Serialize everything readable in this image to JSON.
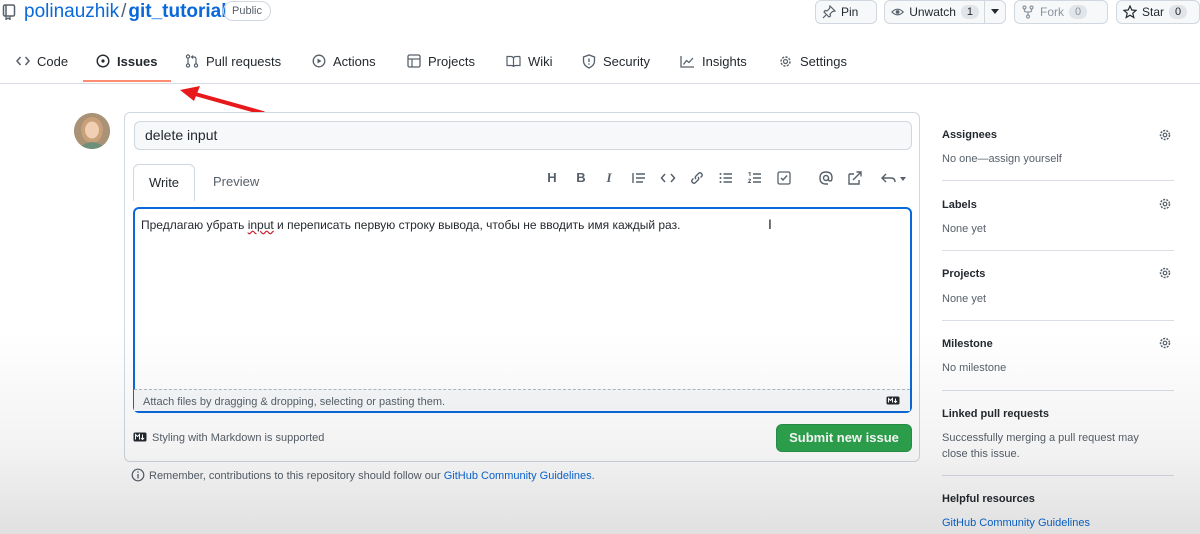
{
  "repo": {
    "owner": "polinauzhik",
    "separator": "/",
    "name": "git_tutorial",
    "visibility": "Public"
  },
  "header_buttons": {
    "pin": "Pin",
    "unwatch": "Unwatch",
    "unwatch_count": "1",
    "fork": "Fork",
    "fork_count": "0",
    "star": "Star",
    "star_count": "0"
  },
  "tabs": [
    {
      "label": "Code",
      "icon": "code-icon"
    },
    {
      "label": "Issues",
      "icon": "issue-opened-icon"
    },
    {
      "label": "Pull requests",
      "icon": "git-pull-request-icon"
    },
    {
      "label": "Actions",
      "icon": "play-icon"
    },
    {
      "label": "Projects",
      "icon": "table-icon"
    },
    {
      "label": "Wiki",
      "icon": "book-icon"
    },
    {
      "label": "Security",
      "icon": "shield-icon"
    },
    {
      "label": "Insights",
      "icon": "graph-icon"
    },
    {
      "label": "Settings",
      "icon": "gear-icon"
    }
  ],
  "active_tab": "Issues",
  "issue_form": {
    "title_value": "delete input",
    "write_tab": "Write",
    "preview_tab": "Preview",
    "body_before": "Предлагаю убрать ",
    "body_error_word": "input",
    "body_after": " и переписать первую строку вывода, чтобы не вводить имя каждый раз.",
    "attach_hint": "Attach files by dragging & dropping, selecting or pasting them.",
    "markdown_note": "Styling with Markdown is supported",
    "submit_label": "Submit new issue",
    "remember_text": "Remember, contributions to this repository should follow our ",
    "remember_link": "GitHub Community Guidelines",
    "remember_end": "."
  },
  "toolbar": {
    "heading": "H",
    "bold": "B",
    "italic": "I"
  },
  "sidebar": {
    "assignees_title": "Assignees",
    "assignees_value": "No one—assign yourself",
    "labels_title": "Labels",
    "labels_value": "None yet",
    "projects_title": "Projects",
    "projects_value": "None yet",
    "milestone_title": "Milestone",
    "milestone_value": "No milestone",
    "linked_title": "Linked pull requests",
    "linked_line1": "Successfully merging a pull request may",
    "linked_line2": "close this issue.",
    "helpful_title": "Helpful resources",
    "helpful_link": "GitHub Community Guidelines"
  },
  "colors": {
    "link": "#0969da",
    "accent_underline": "#fd8c73",
    "submit_green": "#2da44e",
    "annotation_arrow": "#e8191b"
  }
}
